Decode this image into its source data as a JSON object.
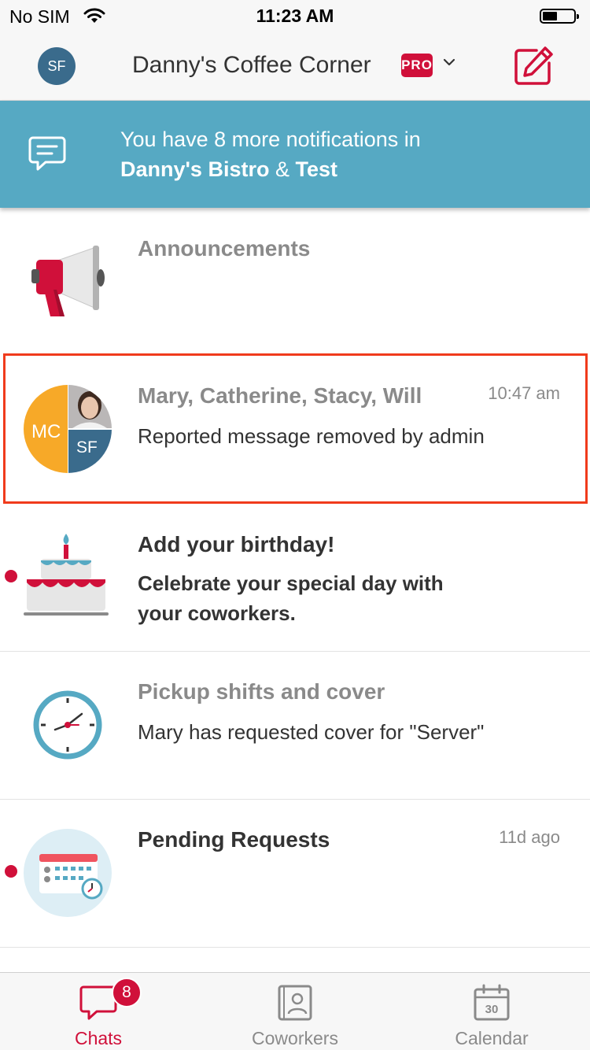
{
  "status_bar": {
    "carrier": "No SIM",
    "time": "11:23 AM"
  },
  "header": {
    "avatar_initials": "SF",
    "title": "Danny's Coffee Corner",
    "badge": "PRO"
  },
  "banner": {
    "line1": "You have 8 more notifications in",
    "place1": "Danny's Bistro",
    "conjunction": " & ",
    "place2": "Test"
  },
  "feed": [
    {
      "title": "Announcements",
      "icon": "megaphone-icon"
    },
    {
      "title": "Mary, Catherine, Stacy, Will",
      "subtitle": "Reported message removed by admin",
      "time": "10:47 am",
      "avatar_left": "MC",
      "avatar_right": "SF",
      "highlighted": true
    },
    {
      "title": "Add your birthday!",
      "subtitle_line1": "Celebrate your special day with",
      "subtitle_line2": "your coworkers.",
      "icon": "birthday-cake-icon",
      "unread": true
    },
    {
      "title": "Pickup shifts and cover",
      "subtitle": "Mary has requested cover for  \"Server\"",
      "icon": "clock-icon"
    },
    {
      "title": "Pending Requests",
      "time": "11d ago",
      "icon": "calendar-request-icon",
      "unread": true
    }
  ],
  "tabs": [
    {
      "label": "Chats",
      "badge": "8",
      "icon": "chat-bubble-icon",
      "active": true
    },
    {
      "label": "Coworkers",
      "icon": "contact-book-icon",
      "active": false
    },
    {
      "label": "Calendar",
      "icon": "calendar-icon",
      "calendar_day": "30",
      "active": false
    }
  ],
  "colors": {
    "accent": "#d0103a",
    "banner": "#56a9c3",
    "avatar": "#3a6b8c",
    "group_avatar_left": "#f7a928",
    "highlight_border": "#f03b1c"
  }
}
